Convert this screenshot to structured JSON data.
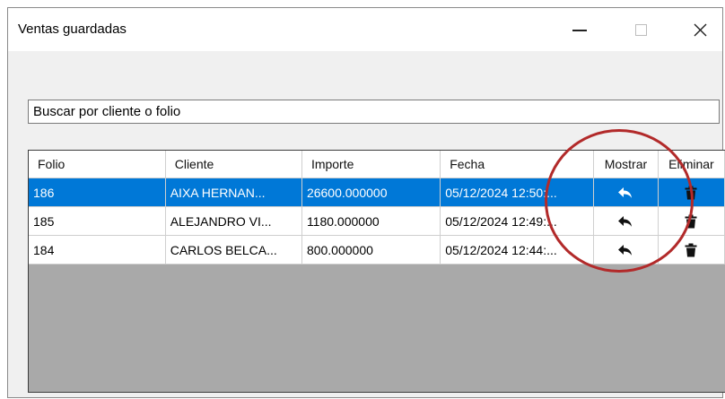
{
  "window": {
    "title": "Ventas guardadas",
    "controls": [
      "minimize",
      "maximize",
      "close"
    ]
  },
  "search": {
    "value": "Buscar por cliente o folio"
  },
  "table": {
    "columns": [
      "Folio",
      "Cliente",
      "Importe",
      "Fecha",
      "Mostrar",
      "Eliminar"
    ],
    "rows": [
      {
        "folio": "186",
        "cliente": "AIXA HERNAN...",
        "importe": "26600.000000",
        "fecha": "05/12/2024 12:50:...",
        "mostrar_icon": "reply-arrow-icon",
        "eliminar_icon": "trash-icon",
        "selected": true
      },
      {
        "folio": "185",
        "cliente": "ALEJANDRO VI...",
        "importe": "1180.000000",
        "fecha": "05/12/2024 12:49:...",
        "mostrar_icon": "reply-arrow-icon",
        "eliminar_icon": "trash-icon",
        "selected": false
      },
      {
        "folio": "184",
        "cliente": "CARLOS BELCA...",
        "importe": "800.000000",
        "fecha": "05/12/2024 12:44:...",
        "mostrar_icon": "reply-arrow-icon",
        "eliminar_icon": "trash-icon",
        "selected": false
      }
    ]
  },
  "colors": {
    "selection": "#0078d7",
    "grid_background": "#a9a9a9",
    "annotation_circle": "#b22a2a"
  }
}
